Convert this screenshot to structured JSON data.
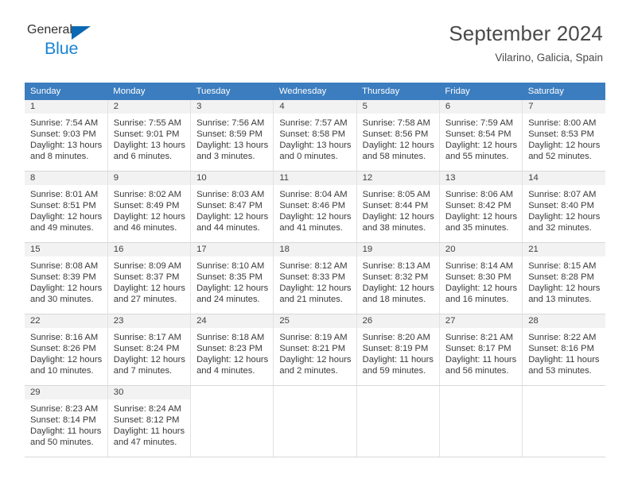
{
  "brand": {
    "name_part1": "General",
    "name_part2": "Blue",
    "accent_color": "#1b84d4",
    "triangle_color": "#0b68b3"
  },
  "header": {
    "title": "September 2024",
    "subtitle": "Vilarino, Galicia, Spain"
  },
  "calendar": {
    "header_bg": "#3b7dbf",
    "daynum_band_bg": "#f2f2f2",
    "weekday_headers": [
      "Sunday",
      "Monday",
      "Tuesday",
      "Wednesday",
      "Thursday",
      "Friday",
      "Saturday"
    ],
    "weeks": [
      [
        {
          "day": "1",
          "sunrise": "Sunrise: 7:54 AM",
          "sunset": "Sunset: 9:03 PM",
          "daylight_line1": "Daylight: 13 hours",
          "daylight_line2": "and 8 minutes."
        },
        {
          "day": "2",
          "sunrise": "Sunrise: 7:55 AM",
          "sunset": "Sunset: 9:01 PM",
          "daylight_line1": "Daylight: 13 hours",
          "daylight_line2": "and 6 minutes."
        },
        {
          "day": "3",
          "sunrise": "Sunrise: 7:56 AM",
          "sunset": "Sunset: 8:59 PM",
          "daylight_line1": "Daylight: 13 hours",
          "daylight_line2": "and 3 minutes."
        },
        {
          "day": "4",
          "sunrise": "Sunrise: 7:57 AM",
          "sunset": "Sunset: 8:58 PM",
          "daylight_line1": "Daylight: 13 hours",
          "daylight_line2": "and 0 minutes."
        },
        {
          "day": "5",
          "sunrise": "Sunrise: 7:58 AM",
          "sunset": "Sunset: 8:56 PM",
          "daylight_line1": "Daylight: 12 hours",
          "daylight_line2": "and 58 minutes."
        },
        {
          "day": "6",
          "sunrise": "Sunrise: 7:59 AM",
          "sunset": "Sunset: 8:54 PM",
          "daylight_line1": "Daylight: 12 hours",
          "daylight_line2": "and 55 minutes."
        },
        {
          "day": "7",
          "sunrise": "Sunrise: 8:00 AM",
          "sunset": "Sunset: 8:53 PM",
          "daylight_line1": "Daylight: 12 hours",
          "daylight_line2": "and 52 minutes."
        }
      ],
      [
        {
          "day": "8",
          "sunrise": "Sunrise: 8:01 AM",
          "sunset": "Sunset: 8:51 PM",
          "daylight_line1": "Daylight: 12 hours",
          "daylight_line2": "and 49 minutes."
        },
        {
          "day": "9",
          "sunrise": "Sunrise: 8:02 AM",
          "sunset": "Sunset: 8:49 PM",
          "daylight_line1": "Daylight: 12 hours",
          "daylight_line2": "and 46 minutes."
        },
        {
          "day": "10",
          "sunrise": "Sunrise: 8:03 AM",
          "sunset": "Sunset: 8:47 PM",
          "daylight_line1": "Daylight: 12 hours",
          "daylight_line2": "and 44 minutes."
        },
        {
          "day": "11",
          "sunrise": "Sunrise: 8:04 AM",
          "sunset": "Sunset: 8:46 PM",
          "daylight_line1": "Daylight: 12 hours",
          "daylight_line2": "and 41 minutes."
        },
        {
          "day": "12",
          "sunrise": "Sunrise: 8:05 AM",
          "sunset": "Sunset: 8:44 PM",
          "daylight_line1": "Daylight: 12 hours",
          "daylight_line2": "and 38 minutes."
        },
        {
          "day": "13",
          "sunrise": "Sunrise: 8:06 AM",
          "sunset": "Sunset: 8:42 PM",
          "daylight_line1": "Daylight: 12 hours",
          "daylight_line2": "and 35 minutes."
        },
        {
          "day": "14",
          "sunrise": "Sunrise: 8:07 AM",
          "sunset": "Sunset: 8:40 PM",
          "daylight_line1": "Daylight: 12 hours",
          "daylight_line2": "and 32 minutes."
        }
      ],
      [
        {
          "day": "15",
          "sunrise": "Sunrise: 8:08 AM",
          "sunset": "Sunset: 8:39 PM",
          "daylight_line1": "Daylight: 12 hours",
          "daylight_line2": "and 30 minutes."
        },
        {
          "day": "16",
          "sunrise": "Sunrise: 8:09 AM",
          "sunset": "Sunset: 8:37 PM",
          "daylight_line1": "Daylight: 12 hours",
          "daylight_line2": "and 27 minutes."
        },
        {
          "day": "17",
          "sunrise": "Sunrise: 8:10 AM",
          "sunset": "Sunset: 8:35 PM",
          "daylight_line1": "Daylight: 12 hours",
          "daylight_line2": "and 24 minutes."
        },
        {
          "day": "18",
          "sunrise": "Sunrise: 8:12 AM",
          "sunset": "Sunset: 8:33 PM",
          "daylight_line1": "Daylight: 12 hours",
          "daylight_line2": "and 21 minutes."
        },
        {
          "day": "19",
          "sunrise": "Sunrise: 8:13 AM",
          "sunset": "Sunset: 8:32 PM",
          "daylight_line1": "Daylight: 12 hours",
          "daylight_line2": "and 18 minutes."
        },
        {
          "day": "20",
          "sunrise": "Sunrise: 8:14 AM",
          "sunset": "Sunset: 8:30 PM",
          "daylight_line1": "Daylight: 12 hours",
          "daylight_line2": "and 16 minutes."
        },
        {
          "day": "21",
          "sunrise": "Sunrise: 8:15 AM",
          "sunset": "Sunset: 8:28 PM",
          "daylight_line1": "Daylight: 12 hours",
          "daylight_line2": "and 13 minutes."
        }
      ],
      [
        {
          "day": "22",
          "sunrise": "Sunrise: 8:16 AM",
          "sunset": "Sunset: 8:26 PM",
          "daylight_line1": "Daylight: 12 hours",
          "daylight_line2": "and 10 minutes."
        },
        {
          "day": "23",
          "sunrise": "Sunrise: 8:17 AM",
          "sunset": "Sunset: 8:24 PM",
          "daylight_line1": "Daylight: 12 hours",
          "daylight_line2": "and 7 minutes."
        },
        {
          "day": "24",
          "sunrise": "Sunrise: 8:18 AM",
          "sunset": "Sunset: 8:23 PM",
          "daylight_line1": "Daylight: 12 hours",
          "daylight_line2": "and 4 minutes."
        },
        {
          "day": "25",
          "sunrise": "Sunrise: 8:19 AM",
          "sunset": "Sunset: 8:21 PM",
          "daylight_line1": "Daylight: 12 hours",
          "daylight_line2": "and 2 minutes."
        },
        {
          "day": "26",
          "sunrise": "Sunrise: 8:20 AM",
          "sunset": "Sunset: 8:19 PM",
          "daylight_line1": "Daylight: 11 hours",
          "daylight_line2": "and 59 minutes."
        },
        {
          "day": "27",
          "sunrise": "Sunrise: 8:21 AM",
          "sunset": "Sunset: 8:17 PM",
          "daylight_line1": "Daylight: 11 hours",
          "daylight_line2": "and 56 minutes."
        },
        {
          "day": "28",
          "sunrise": "Sunrise: 8:22 AM",
          "sunset": "Sunset: 8:16 PM",
          "daylight_line1": "Daylight: 11 hours",
          "daylight_line2": "and 53 minutes."
        }
      ],
      [
        {
          "day": "29",
          "sunrise": "Sunrise: 8:23 AM",
          "sunset": "Sunset: 8:14 PM",
          "daylight_line1": "Daylight: 11 hours",
          "daylight_line2": "and 50 minutes."
        },
        {
          "day": "30",
          "sunrise": "Sunrise: 8:24 AM",
          "sunset": "Sunset: 8:12 PM",
          "daylight_line1": "Daylight: 11 hours",
          "daylight_line2": "and 47 minutes."
        },
        {
          "day": "",
          "sunrise": "",
          "sunset": "",
          "daylight_line1": "",
          "daylight_line2": ""
        },
        {
          "day": "",
          "sunrise": "",
          "sunset": "",
          "daylight_line1": "",
          "daylight_line2": ""
        },
        {
          "day": "",
          "sunrise": "",
          "sunset": "",
          "daylight_line1": "",
          "daylight_line2": ""
        },
        {
          "day": "",
          "sunrise": "",
          "sunset": "",
          "daylight_line1": "",
          "daylight_line2": ""
        },
        {
          "day": "",
          "sunrise": "",
          "sunset": "",
          "daylight_line1": "",
          "daylight_line2": ""
        }
      ]
    ]
  }
}
